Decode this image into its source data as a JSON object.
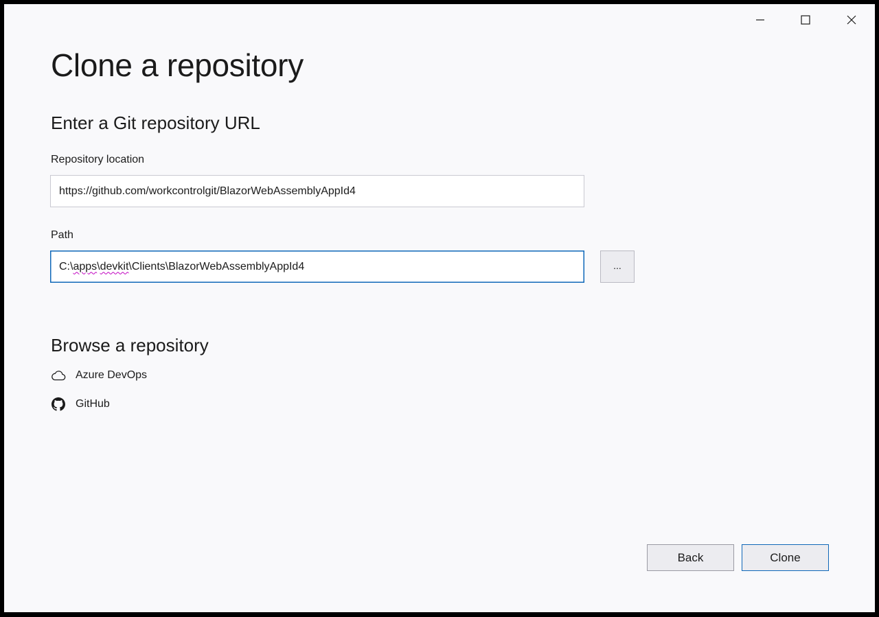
{
  "window": {
    "controls": {
      "minimize_icon": "minimize-icon",
      "maximize_icon": "maximize-icon",
      "close_icon": "close-icon"
    }
  },
  "page": {
    "title": "Clone a repository",
    "subtitle": "Enter a Git repository URL"
  },
  "form": {
    "repository_label": "Repository location",
    "repository_value": "https://github.com/workcontrolgit/BlazorWebAssemblyAppId4",
    "path_label": "Path",
    "path_prefix": "C:\\",
    "path_seg1": "apps",
    "path_sep1": "\\",
    "path_seg2": "devkit",
    "path_rest": "\\Clients\\BlazorWebAssemblyAppId4",
    "browse_label": "..."
  },
  "browse": {
    "title": "Browse a repository",
    "providers": [
      {
        "label": "Azure DevOps",
        "icon": "cloud-icon"
      },
      {
        "label": "GitHub",
        "icon": "github-icon"
      }
    ]
  },
  "footer": {
    "back_label": "Back",
    "clone_label": "Clone"
  },
  "colors": {
    "accent": "#0e67b8",
    "background": "#f9f9fb",
    "spellcheck": "#c000c0"
  }
}
